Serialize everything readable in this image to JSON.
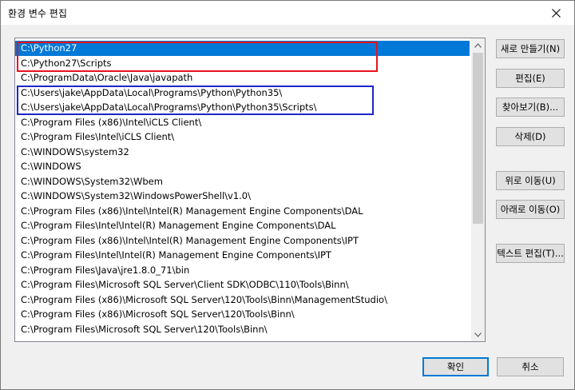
{
  "window": {
    "title": "환경 변수 편집"
  },
  "paths": [
    "C:\\Python27",
    "C:\\Python27\\Scripts",
    "C:\\ProgramData\\Oracle\\Java\\javapath",
    "C:\\Users\\jake\\AppData\\Local\\Programs\\Python\\Python35\\",
    "C:\\Users\\jake\\AppData\\Local\\Programs\\Python\\Python35\\Scripts\\",
    "C:\\Program Files (x86)\\Intel\\iCLS Client\\",
    "C:\\Program Files\\Intel\\iCLS Client\\",
    "C:\\WINDOWS\\system32",
    "C:\\WINDOWS",
    "C:\\WINDOWS\\System32\\Wbem",
    "C:\\WINDOWS\\System32\\WindowsPowerShell\\v1.0\\",
    "C:\\Program Files (x86)\\Intel\\Intel(R) Management Engine Components\\DAL",
    "C:\\Program Files\\Intel\\Intel(R) Management Engine Components\\DAL",
    "C:\\Program Files (x86)\\Intel\\Intel(R) Management Engine Components\\IPT",
    "C:\\Program Files\\Intel\\Intel(R) Management Engine Components\\IPT",
    "C:\\Program Files\\Java\\jre1.8.0_71\\bin",
    "C:\\Program Files\\Microsoft SQL Server\\Client SDK\\ODBC\\110\\Tools\\Binn\\",
    "C:\\Program Files (x86)\\Microsoft SQL Server\\120\\Tools\\Binn\\ManagementStudio\\",
    "C:\\Program Files (x86)\\Microsoft SQL Server\\120\\Tools\\Binn\\",
    "C:\\Program Files\\Microsoft SQL Server\\120\\Tools\\Binn\\"
  ],
  "selected_index": 0,
  "buttons": {
    "new": "새로 만들기(N)",
    "edit": "편집(E)",
    "browse": "찾아보기(B)...",
    "delete": "삭제(D)",
    "move_up": "위로 이동(U)",
    "move_down": "아래로 이동(O)",
    "edit_text": "텍스트 편집(T)...",
    "ok": "확인",
    "cancel": "취소"
  },
  "colors": {
    "selection": "#0078d7",
    "highlight_red": "#e8121d",
    "highlight_blue": "#1e24c8"
  }
}
